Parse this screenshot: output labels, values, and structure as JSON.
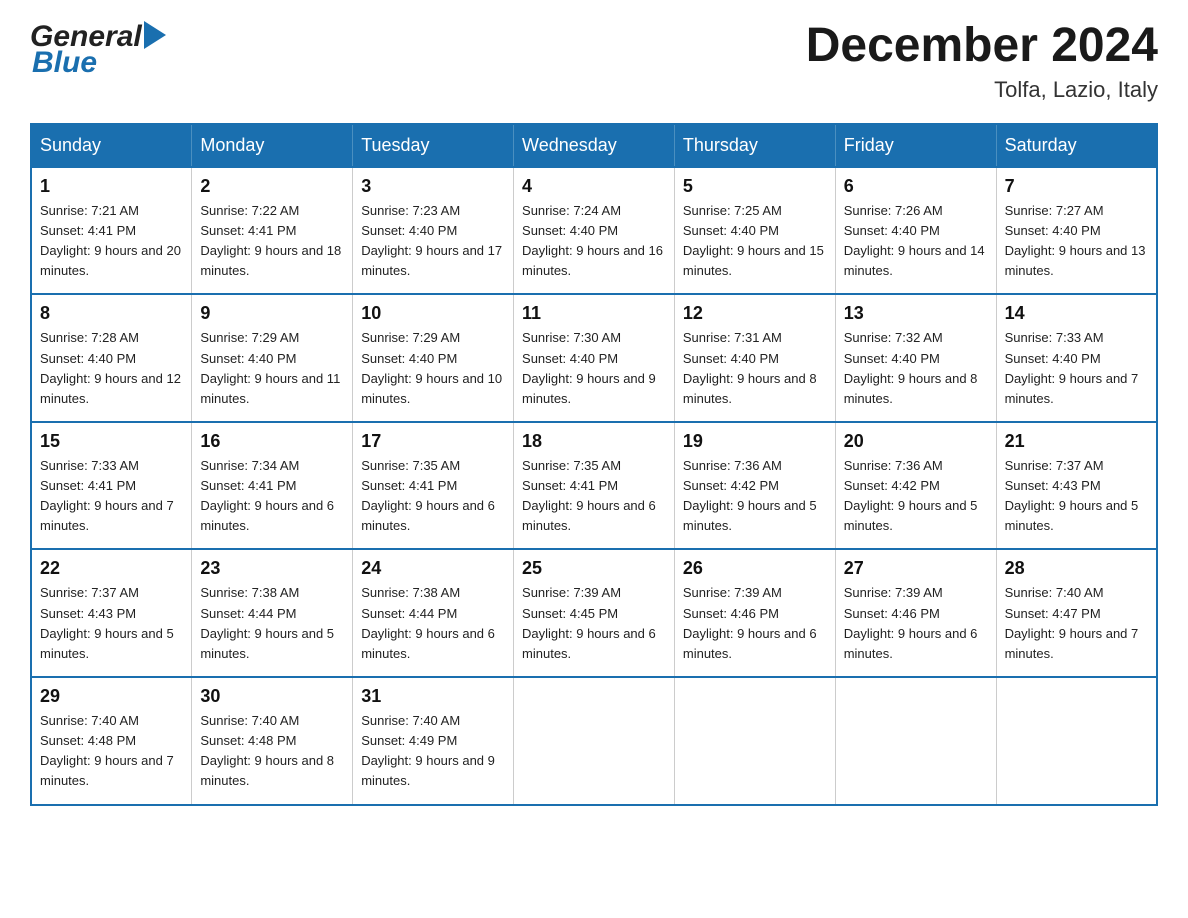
{
  "logo": {
    "general": "General",
    "arrow": "▶",
    "blue": "Blue"
  },
  "header": {
    "title": "December 2024",
    "subtitle": "Tolfa, Lazio, Italy"
  },
  "days_of_week": [
    "Sunday",
    "Monday",
    "Tuesday",
    "Wednesday",
    "Thursday",
    "Friday",
    "Saturday"
  ],
  "weeks": [
    [
      {
        "day": "1",
        "sunrise": "Sunrise: 7:21 AM",
        "sunset": "Sunset: 4:41 PM",
        "daylight": "Daylight: 9 hours and 20 minutes."
      },
      {
        "day": "2",
        "sunrise": "Sunrise: 7:22 AM",
        "sunset": "Sunset: 4:41 PM",
        "daylight": "Daylight: 9 hours and 18 minutes."
      },
      {
        "day": "3",
        "sunrise": "Sunrise: 7:23 AM",
        "sunset": "Sunset: 4:40 PM",
        "daylight": "Daylight: 9 hours and 17 minutes."
      },
      {
        "day": "4",
        "sunrise": "Sunrise: 7:24 AM",
        "sunset": "Sunset: 4:40 PM",
        "daylight": "Daylight: 9 hours and 16 minutes."
      },
      {
        "day": "5",
        "sunrise": "Sunrise: 7:25 AM",
        "sunset": "Sunset: 4:40 PM",
        "daylight": "Daylight: 9 hours and 15 minutes."
      },
      {
        "day": "6",
        "sunrise": "Sunrise: 7:26 AM",
        "sunset": "Sunset: 4:40 PM",
        "daylight": "Daylight: 9 hours and 14 minutes."
      },
      {
        "day": "7",
        "sunrise": "Sunrise: 7:27 AM",
        "sunset": "Sunset: 4:40 PM",
        "daylight": "Daylight: 9 hours and 13 minutes."
      }
    ],
    [
      {
        "day": "8",
        "sunrise": "Sunrise: 7:28 AM",
        "sunset": "Sunset: 4:40 PM",
        "daylight": "Daylight: 9 hours and 12 minutes."
      },
      {
        "day": "9",
        "sunrise": "Sunrise: 7:29 AM",
        "sunset": "Sunset: 4:40 PM",
        "daylight": "Daylight: 9 hours and 11 minutes."
      },
      {
        "day": "10",
        "sunrise": "Sunrise: 7:29 AM",
        "sunset": "Sunset: 4:40 PM",
        "daylight": "Daylight: 9 hours and 10 minutes."
      },
      {
        "day": "11",
        "sunrise": "Sunrise: 7:30 AM",
        "sunset": "Sunset: 4:40 PM",
        "daylight": "Daylight: 9 hours and 9 minutes."
      },
      {
        "day": "12",
        "sunrise": "Sunrise: 7:31 AM",
        "sunset": "Sunset: 4:40 PM",
        "daylight": "Daylight: 9 hours and 8 minutes."
      },
      {
        "day": "13",
        "sunrise": "Sunrise: 7:32 AM",
        "sunset": "Sunset: 4:40 PM",
        "daylight": "Daylight: 9 hours and 8 minutes."
      },
      {
        "day": "14",
        "sunrise": "Sunrise: 7:33 AM",
        "sunset": "Sunset: 4:40 PM",
        "daylight": "Daylight: 9 hours and 7 minutes."
      }
    ],
    [
      {
        "day": "15",
        "sunrise": "Sunrise: 7:33 AM",
        "sunset": "Sunset: 4:41 PM",
        "daylight": "Daylight: 9 hours and 7 minutes."
      },
      {
        "day": "16",
        "sunrise": "Sunrise: 7:34 AM",
        "sunset": "Sunset: 4:41 PM",
        "daylight": "Daylight: 9 hours and 6 minutes."
      },
      {
        "day": "17",
        "sunrise": "Sunrise: 7:35 AM",
        "sunset": "Sunset: 4:41 PM",
        "daylight": "Daylight: 9 hours and 6 minutes."
      },
      {
        "day": "18",
        "sunrise": "Sunrise: 7:35 AM",
        "sunset": "Sunset: 4:41 PM",
        "daylight": "Daylight: 9 hours and 6 minutes."
      },
      {
        "day": "19",
        "sunrise": "Sunrise: 7:36 AM",
        "sunset": "Sunset: 4:42 PM",
        "daylight": "Daylight: 9 hours and 5 minutes."
      },
      {
        "day": "20",
        "sunrise": "Sunrise: 7:36 AM",
        "sunset": "Sunset: 4:42 PM",
        "daylight": "Daylight: 9 hours and 5 minutes."
      },
      {
        "day": "21",
        "sunrise": "Sunrise: 7:37 AM",
        "sunset": "Sunset: 4:43 PM",
        "daylight": "Daylight: 9 hours and 5 minutes."
      }
    ],
    [
      {
        "day": "22",
        "sunrise": "Sunrise: 7:37 AM",
        "sunset": "Sunset: 4:43 PM",
        "daylight": "Daylight: 9 hours and 5 minutes."
      },
      {
        "day": "23",
        "sunrise": "Sunrise: 7:38 AM",
        "sunset": "Sunset: 4:44 PM",
        "daylight": "Daylight: 9 hours and 5 minutes."
      },
      {
        "day": "24",
        "sunrise": "Sunrise: 7:38 AM",
        "sunset": "Sunset: 4:44 PM",
        "daylight": "Daylight: 9 hours and 6 minutes."
      },
      {
        "day": "25",
        "sunrise": "Sunrise: 7:39 AM",
        "sunset": "Sunset: 4:45 PM",
        "daylight": "Daylight: 9 hours and 6 minutes."
      },
      {
        "day": "26",
        "sunrise": "Sunrise: 7:39 AM",
        "sunset": "Sunset: 4:46 PM",
        "daylight": "Daylight: 9 hours and 6 minutes."
      },
      {
        "day": "27",
        "sunrise": "Sunrise: 7:39 AM",
        "sunset": "Sunset: 4:46 PM",
        "daylight": "Daylight: 9 hours and 6 minutes."
      },
      {
        "day": "28",
        "sunrise": "Sunrise: 7:40 AM",
        "sunset": "Sunset: 4:47 PM",
        "daylight": "Daylight: 9 hours and 7 minutes."
      }
    ],
    [
      {
        "day": "29",
        "sunrise": "Sunrise: 7:40 AM",
        "sunset": "Sunset: 4:48 PM",
        "daylight": "Daylight: 9 hours and 7 minutes."
      },
      {
        "day": "30",
        "sunrise": "Sunrise: 7:40 AM",
        "sunset": "Sunset: 4:48 PM",
        "daylight": "Daylight: 9 hours and 8 minutes."
      },
      {
        "day": "31",
        "sunrise": "Sunrise: 7:40 AM",
        "sunset": "Sunset: 4:49 PM",
        "daylight": "Daylight: 9 hours and 9 minutes."
      },
      null,
      null,
      null,
      null
    ]
  ]
}
